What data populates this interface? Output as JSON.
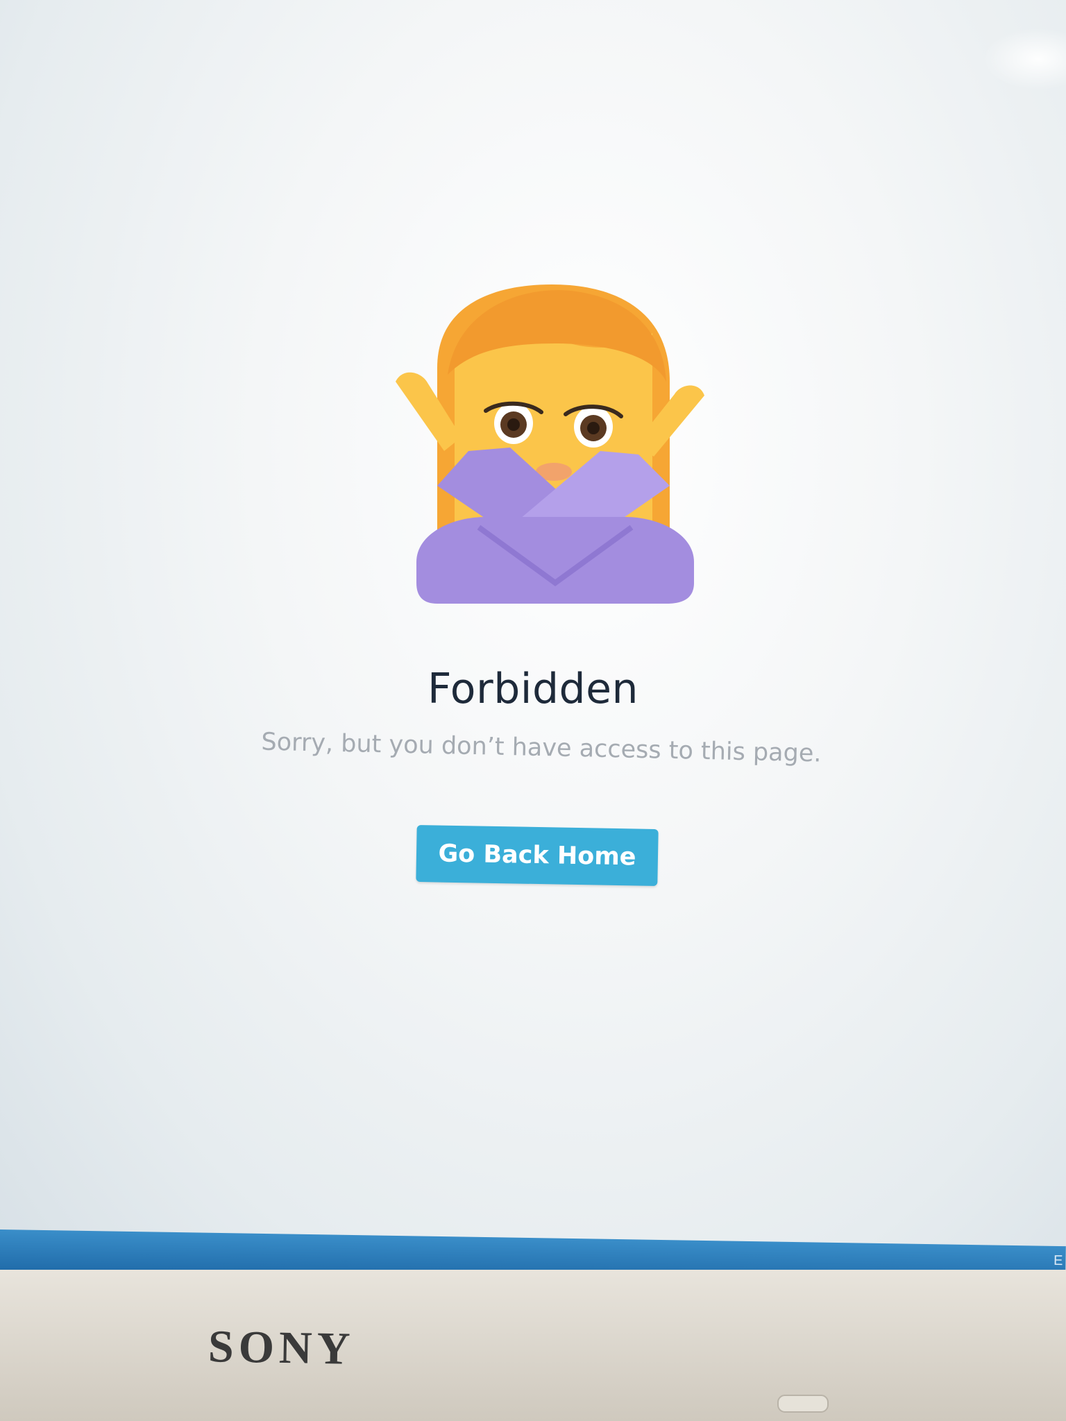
{
  "page": {
    "title": "Forbidden",
    "message": "Sorry, but you don’t have access to this page.",
    "button_label": "Go Back Home",
    "illustration": "woman-gesturing-no-icon"
  },
  "taskbar": {
    "edge_text": "E"
  },
  "monitor": {
    "brand": "SONY"
  },
  "colors": {
    "button": "#3bafd9",
    "title": "#1e2a3a",
    "message": "#a5abb2",
    "hair": "#f29a2e",
    "skin": "#fbc54a",
    "sleeves": "#a38ddf",
    "taskbar": "#2a7dbd"
  }
}
